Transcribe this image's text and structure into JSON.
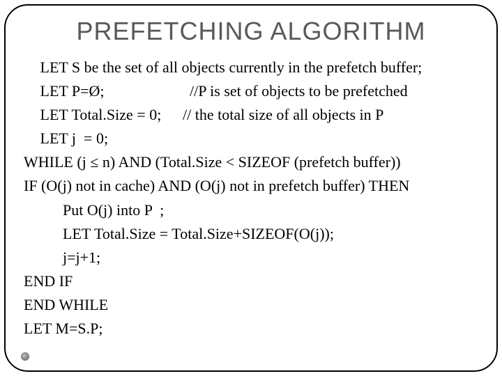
{
  "title": "PREFETCHING ALGORITHM",
  "lines": {
    "l0": " LET S be the set of all objects currently in the prefetch buffer;",
    "l1l": " LET P=Ø;",
    "l1r": "//P is set of objects to be prefetched",
    "l2l": " LET Total.Size = 0;",
    "l2r": "// the total size of all objects in P",
    "l3": " LET j  = 0;",
    "l4": "WHILE (j ≤ n) AND (Total.Size < SIZEOF (prefetch buffer))",
    "l5": "IF (O(j) not in cache) AND (O(j) not in prefetch buffer) THEN",
    "l6": "Put O(j) into P  ;",
    "l7": "LET Total.Size = Total.Size+SIZEOF(O(j));",
    "l8": "j=j+1;",
    "l9": "END IF",
    "l10": "END WHILE",
    "l11": "LET M=S.P;"
  }
}
